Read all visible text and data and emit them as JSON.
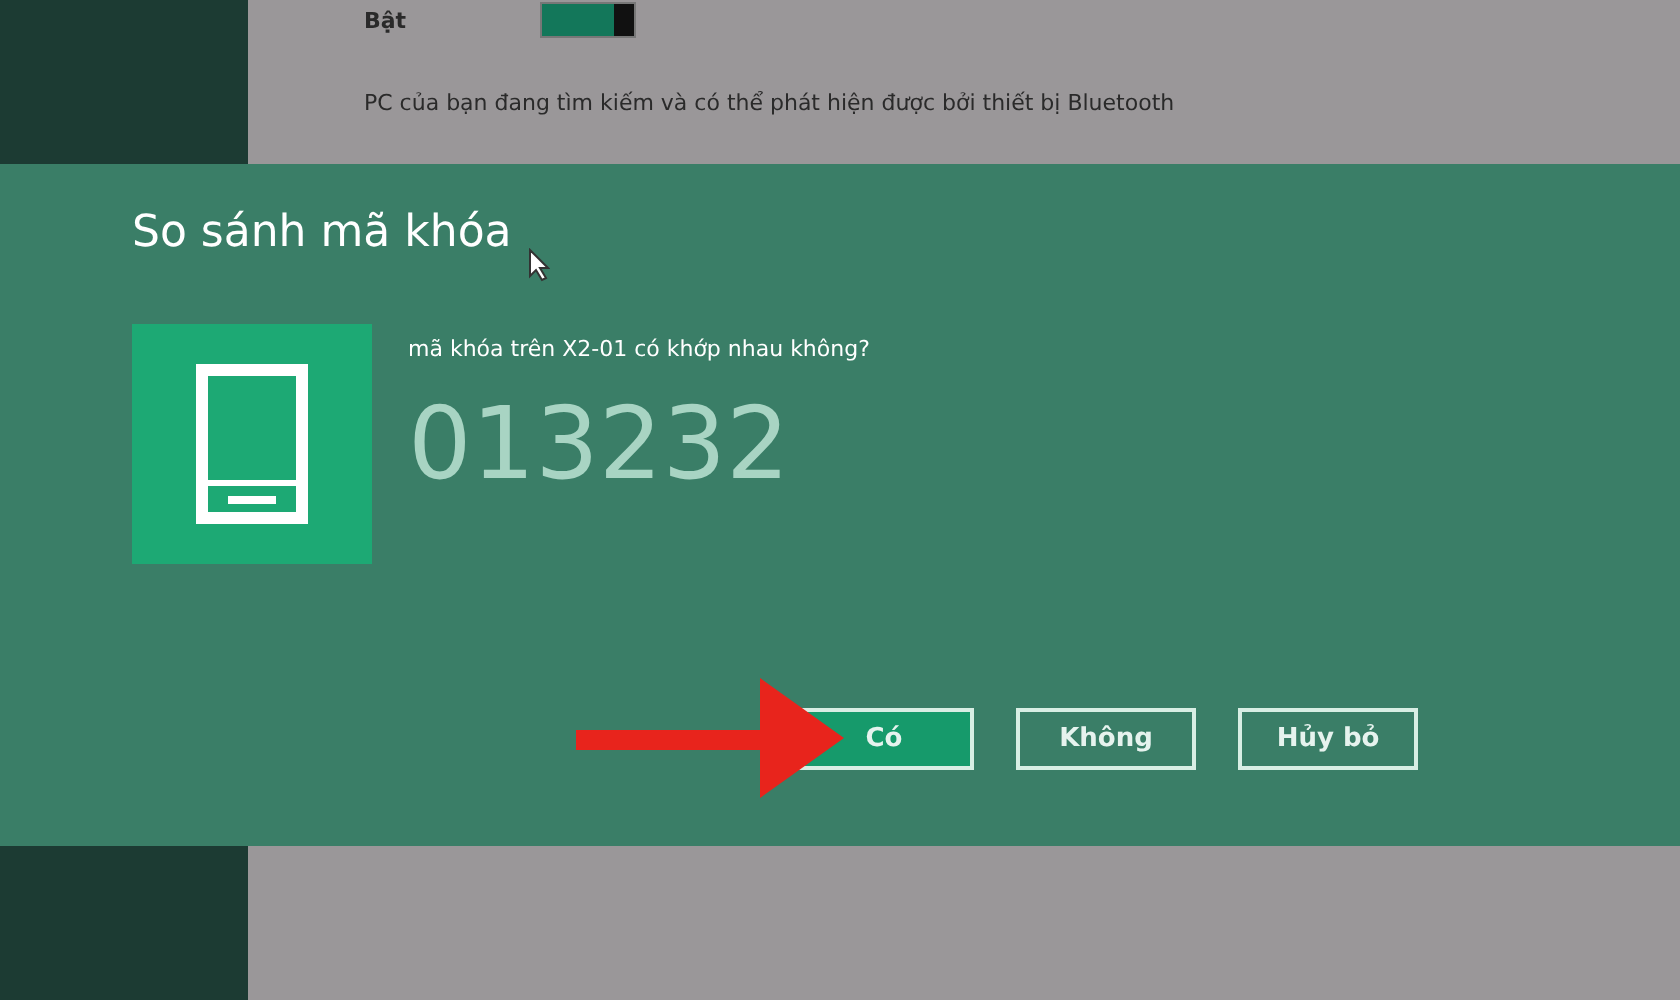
{
  "settings": {
    "label": "Bật",
    "on": true,
    "description": "PC của bạn đang tìm kiếm và có thể phát hiện được bởi thiết bị Bluetooth"
  },
  "dialog": {
    "title": "So sánh mã khóa",
    "question": "mã khóa trên X2-01 có khớp nhau không?",
    "code": "013232",
    "buttons": [
      {
        "label": "Có",
        "kind": "primary"
      },
      {
        "label": "Không",
        "kind": "secondary"
      },
      {
        "label": "Hủy bỏ",
        "kind": "secondary"
      }
    ]
  }
}
